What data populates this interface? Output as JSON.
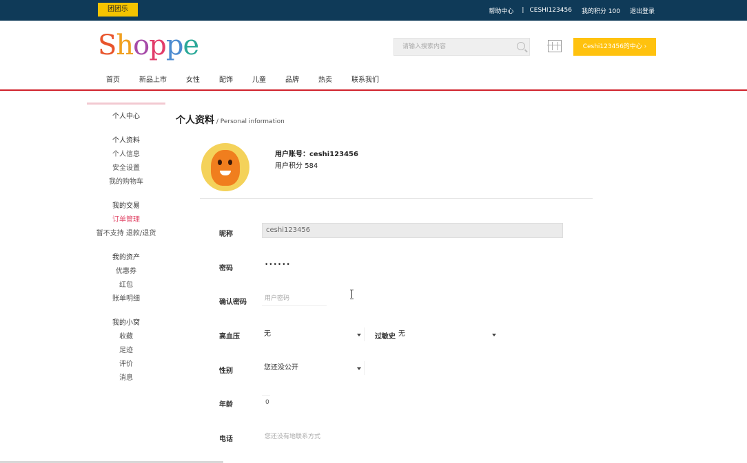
{
  "topbar": {
    "tuan_label": "团团乐",
    "help": "帮助中心",
    "separator": "|",
    "username": "CESHI123456",
    "points": "我的积分 100",
    "logout": "退出登录"
  },
  "header": {
    "logo_letters": [
      "S",
      "h",
      "o",
      "p",
      "p",
      "e"
    ],
    "search_placeholder": "请输入搜索内容",
    "user_center_button": "Ceshi123456的中心 ›"
  },
  "nav": [
    "首页",
    "新品上市",
    "女性",
    "配饰",
    "儿童",
    "品牌",
    "热卖",
    "联系我们"
  ],
  "sidebar": {
    "title": "个人中心",
    "items": [
      "个人资料",
      "个人信息",
      "安全设置",
      "我的购物车",
      "我的交易",
      "订单管理",
      "暂不支持 退款/退货",
      "我的资产",
      "优惠券",
      "红包",
      "账单明细",
      "我的小窝",
      "收藏",
      "足迹",
      "评价",
      "消息"
    ]
  },
  "page": {
    "title": "个人资料",
    "subtitle": " / Personal information"
  },
  "account": {
    "id_label": "用户账号：",
    "id_value": "ceshi123456",
    "points_label": "用户积分 ",
    "points_value": "584"
  },
  "form": {
    "nickname_label": "昵称",
    "nickname_value": "ceshi123456",
    "password_label": "密码",
    "password_value": "••••••",
    "confirm_label": "确认密码",
    "confirm_placeholder": "用户密码",
    "hypertension_label": "高血压",
    "hypertension_value": "无",
    "allergy_label": "过敏史",
    "allergy_value": "无",
    "gender_label": "性别",
    "gender_value": "您还没公开",
    "age_label": "年龄",
    "age_value": "0",
    "phone_label": "电话",
    "phone_placeholder": "您还没有地联系方式"
  }
}
